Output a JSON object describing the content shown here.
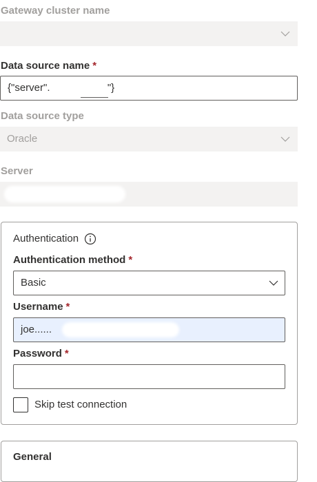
{
  "gateway": {
    "label": "Gateway cluster name",
    "value": ""
  },
  "data_source_name": {
    "label": "Data source name",
    "required_mark": "*",
    "value": "{\"server\".                    \"}"
  },
  "data_source_type": {
    "label": "Data source type",
    "value": "Oracle"
  },
  "server": {
    "label": "Server",
    "value": ""
  },
  "authentication": {
    "title": "Authentication",
    "info_icon": "info-icon",
    "method": {
      "label": "Authentication method",
      "required_mark": "*",
      "value": "Basic"
    },
    "username": {
      "label": "Username",
      "required_mark": "*",
      "value": "joe......"
    },
    "password": {
      "label": "Password",
      "required_mark": "*",
      "value": ""
    },
    "skip_test": {
      "label": "Skip test connection",
      "checked": false
    }
  },
  "general": {
    "title": "General"
  },
  "colors": {
    "disabled_bg": "#f3f2f1",
    "disabled_text": "#a19f9d",
    "required": "#a4262c",
    "autofill_bg": "#e8f0fe",
    "border": "#605e5c"
  }
}
